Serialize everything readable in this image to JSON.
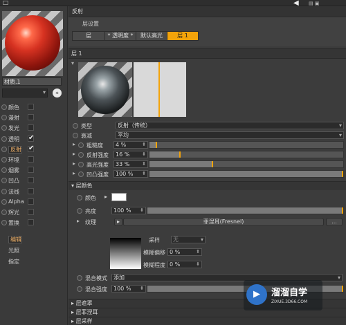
{
  "topbar": {
    "arrow": "◀",
    "winbtns": "▤ ▣"
  },
  "left": {
    "material_name": "材质.1",
    "picker_icon": "pick-icon",
    "channels": [
      {
        "label": "颜色",
        "checked": false,
        "selected": false
      },
      {
        "label": "漫射",
        "checked": false,
        "selected": false
      },
      {
        "label": "发光",
        "checked": false,
        "selected": false
      },
      {
        "label": "透明",
        "checked": true,
        "selected": false
      },
      {
        "label": "反射",
        "checked": true,
        "selected": true
      },
      {
        "label": "环境",
        "checked": false,
        "selected": false
      },
      {
        "label": "烟雾",
        "checked": false,
        "selected": false
      },
      {
        "label": "凹凸",
        "checked": false,
        "selected": false
      },
      {
        "label": "法线",
        "checked": false,
        "selected": false
      },
      {
        "label": "Alpha",
        "checked": false,
        "selected": false
      },
      {
        "label": "辉光",
        "checked": false,
        "selected": false
      },
      {
        "label": "置换",
        "checked": false,
        "selected": false
      }
    ],
    "sub_items": [
      {
        "label": "编辑",
        "selected": true
      },
      {
        "label": "光照",
        "selected": false
      },
      {
        "label": "指定",
        "selected": false
      }
    ]
  },
  "right": {
    "header": "反射",
    "layer_settings": "层设置",
    "tabs": [
      "层",
      "* 透明度 *",
      "默认高光",
      "层 1"
    ],
    "layer_title": "层 1",
    "props": {
      "type_label": "类型",
      "type_value": "反射（传统）",
      "falloff_label": "衰减",
      "falloff_value": "平均",
      "roughness_label": "粗糙度",
      "roughness_value": "4 %",
      "reflect_label": "反射强度",
      "reflect_value": "16 %",
      "specular_label": "高光强度",
      "specular_value": "33 %",
      "bump_label": "凹凸强度",
      "bump_value": "100 %"
    },
    "slider_levels": {
      "roughness": 0.04,
      "reflect": 0.16,
      "specular": 0.33,
      "bump": 1.0
    },
    "layer_color_header": "层颜色",
    "color_label": "颜色",
    "brightness_label": "亮度",
    "brightness_value": "100 %",
    "brightness_level": 1.0,
    "texture_label": "纹理",
    "fresnel_btn": "菲涅耳(Fresnel)",
    "more_btn": "...",
    "sampling_label": "采样",
    "sampling_value": "无",
    "blur_offset_label": "模糊偏移",
    "blur_offset_value": "0 %",
    "blur_level_label": "模糊程度",
    "blur_level_value": "0 %",
    "blend_mode_label": "混合模式",
    "blend_mode_value": "添加",
    "blend_strength_label": "混合强度",
    "blend_strength_value": "100 %",
    "blend_level": 1.0,
    "collapsed_sections": [
      "层遮罩",
      "层菲涅耳",
      "层采样"
    ],
    "watermark_title": "溜溜自学",
    "watermark_url": "ZIXUE.3D66.COM"
  },
  "colors": {
    "accent": "#f3a30a",
    "panel": "#3c3c3c",
    "field": "#2b2b2b"
  }
}
